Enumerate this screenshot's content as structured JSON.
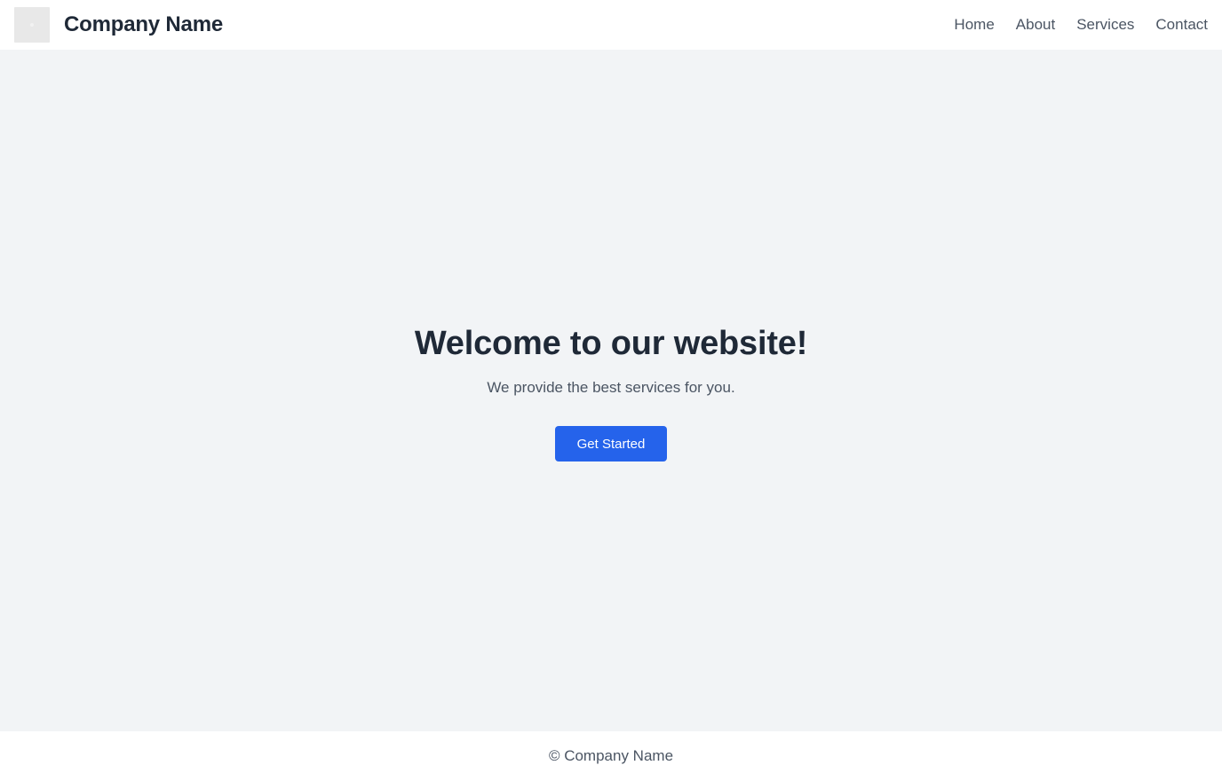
{
  "header": {
    "logo_icon": "image-placeholder-icon",
    "company_name": "Company Name",
    "nav": {
      "home": "Home",
      "about": "About",
      "services": "Services",
      "contact": "Contact"
    }
  },
  "hero": {
    "title": "Welcome to our website!",
    "subtitle": "We provide the best services for you.",
    "cta_label": "Get Started"
  },
  "footer": {
    "text": "© Company Name"
  },
  "colors": {
    "background": "#f2f4f6",
    "surface": "#ffffff",
    "heading": "#1f2937",
    "body_text": "#4b5563",
    "accent": "#2563eb"
  }
}
